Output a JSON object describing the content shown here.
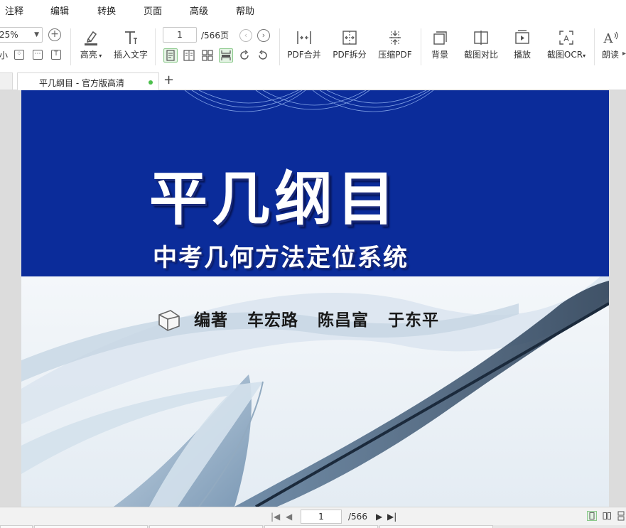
{
  "menu": {
    "items": [
      "注释",
      "编辑",
      "转换",
      "页面",
      "高级",
      "帮助"
    ]
  },
  "toolbar": {
    "zoom_value": "25%",
    "zoom_small_label": "小",
    "highlight_label": "高亮",
    "insert_text_label": "插入文字",
    "page_current": "1",
    "page_total": "/566页",
    "tools": [
      {
        "label": "PDF合并",
        "icon": "merge-icon"
      },
      {
        "label": "PDF拆分",
        "icon": "split-icon"
      },
      {
        "label": "压缩PDF",
        "icon": "compress-icon"
      },
      {
        "label": "背景",
        "icon": "background-icon"
      },
      {
        "label": "截图对比",
        "icon": "compare-icon"
      },
      {
        "label": "播放",
        "icon": "play-icon"
      },
      {
        "label": "截图OCR",
        "icon": "ocr-icon"
      },
      {
        "label": "朗读",
        "icon": "read-aloud-icon"
      }
    ]
  },
  "tabs": {
    "active_title": "平几纲目 - 官方版高清",
    "add_label": "+"
  },
  "document": {
    "title": "平几纲目",
    "subtitle": "中考几何方法定位系统",
    "editor_label": "编著",
    "authors": [
      "车宏路",
      "陈昌富",
      "于东平"
    ]
  },
  "status": {
    "page_current": "1",
    "page_total": "/566"
  },
  "colors": {
    "cover_blue": "#0b2c9a",
    "accent_green": "#4cbf4c",
    "page_bg": "#dcdcdc"
  }
}
